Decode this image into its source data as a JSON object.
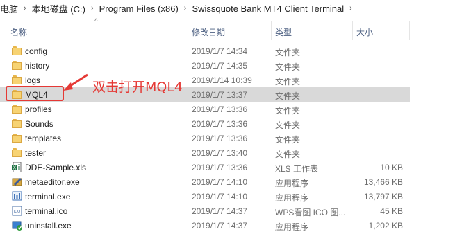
{
  "breadcrumb": {
    "items": [
      "电脑",
      "本地磁盘 (C:)",
      "Program Files (x86)",
      "Swissquote Bank MT4 Client Terminal"
    ],
    "separator": "›"
  },
  "columns": {
    "name": "名称",
    "date": "修改日期",
    "type": "类型",
    "size": "大小"
  },
  "files": [
    {
      "name": "config",
      "date": "2019/1/7 14:34",
      "type": "文件夹",
      "size": "",
      "icon": "folder-icon"
    },
    {
      "name": "history",
      "date": "2019/1/7 14:35",
      "type": "文件夹",
      "size": "",
      "icon": "folder-icon"
    },
    {
      "name": "logs",
      "date": "2019/1/14 10:39",
      "type": "文件夹",
      "size": "",
      "icon": "folder-icon"
    },
    {
      "name": "MQL4",
      "date": "2019/1/7 13:37",
      "type": "文件夹",
      "size": "",
      "icon": "folder-icon"
    },
    {
      "name": "profiles",
      "date": "2019/1/7 13:36",
      "type": "文件夹",
      "size": "",
      "icon": "folder-icon"
    },
    {
      "name": "Sounds",
      "date": "2019/1/7 13:36",
      "type": "文件夹",
      "size": "",
      "icon": "folder-icon"
    },
    {
      "name": "templates",
      "date": "2019/1/7 13:36",
      "type": "文件夹",
      "size": "",
      "icon": "folder-icon"
    },
    {
      "name": "tester",
      "date": "2019/1/7 13:40",
      "type": "文件夹",
      "size": "",
      "icon": "folder-icon"
    },
    {
      "name": "DDE-Sample.xls",
      "date": "2019/1/7 13:36",
      "type": "XLS 工作表",
      "size": "10 KB",
      "icon": "excel-file-icon"
    },
    {
      "name": "metaeditor.exe",
      "date": "2019/1/7 14:10",
      "type": "应用程序",
      "size": "13,466 KB",
      "icon": "metaeditor-app-icon"
    },
    {
      "name": "terminal.exe",
      "date": "2019/1/7 14:10",
      "type": "应用程序",
      "size": "13,797 KB",
      "icon": "terminal-app-icon"
    },
    {
      "name": "terminal.ico",
      "date": "2019/1/7 14:37",
      "type": "WPS看图 ICO 图...",
      "size": "45 KB",
      "icon": "ico-file-icon"
    },
    {
      "name": "uninstall.exe",
      "date": "2019/1/7 14:37",
      "type": "应用程序",
      "size": "1,202 KB",
      "icon": "uninstall-app-icon"
    }
  ],
  "selected_index": 3,
  "annotation": {
    "text": "双击打开MQL4",
    "color": "#e53935"
  }
}
